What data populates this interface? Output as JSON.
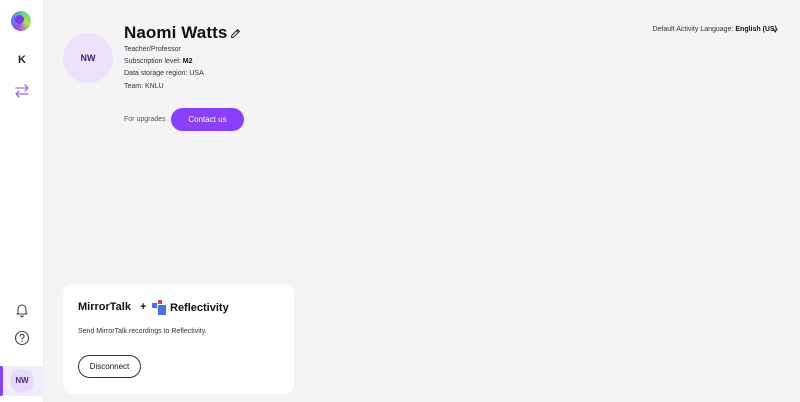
{
  "sidebar": {
    "workspace_initial": "K",
    "user_initials": "NW"
  },
  "profile": {
    "initials": "NW",
    "name": "Naomi Watts",
    "role": "Teacher/Professor",
    "subscription_label": "Subscription level:",
    "subscription_value": "M2",
    "region": "Data storage region: USA",
    "team": "Team: KNLU",
    "upgrade_label": "For upgrades",
    "contact_button": "Contact us"
  },
  "language": {
    "label": "Default Activity Language:",
    "value": "English (US)"
  },
  "integration": {
    "app_name": "MirrorTalk",
    "plus": "+",
    "partner_name": "Reflectivity",
    "description": "Send MirrorTalk recordings to Reflectivity.",
    "disconnect_button": "Disconnect"
  },
  "colors": {
    "accent": "#8a3ffc",
    "background": "#f4f3f6",
    "avatar_bg": "#ece3fa"
  },
  "icons": {
    "logo": "app-logo-icon",
    "swap": "swap-arrows-icon",
    "bell": "bell-icon",
    "help": "help-icon",
    "edit": "pencil-icon",
    "chevron": "chevron-down-icon",
    "partner_logo": "reflectivity-logo-icon"
  }
}
